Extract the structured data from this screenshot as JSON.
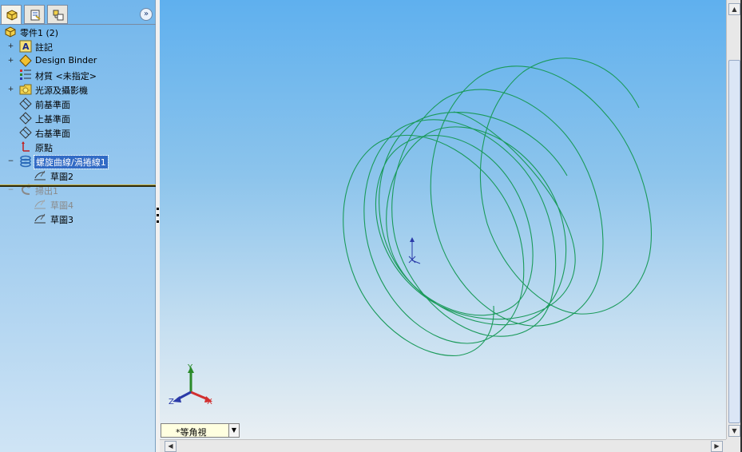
{
  "panel": {
    "tabs": [
      {
        "name": "featuremanager-tab",
        "active": true
      },
      {
        "name": "propertymanager-tab",
        "active": false
      },
      {
        "name": "configurationmanager-tab",
        "active": false
      }
    ],
    "collapse_icon": "double-chevron-right",
    "tree": [
      {
        "label": "零件1  (2)",
        "icon": "part-icon",
        "expander": ""
      },
      {
        "label": "註記",
        "icon": "annotations-icon",
        "expander": "+"
      },
      {
        "label": "Design Binder",
        "icon": "design-binder-icon",
        "expander": "+"
      },
      {
        "label": "材質 <未指定>",
        "icon": "material-icon",
        "expander": ""
      },
      {
        "label": "光源及攝影機",
        "icon": "lights-camera-icon",
        "expander": "+"
      },
      {
        "label": "前基準面",
        "icon": "plane-icon",
        "expander": ""
      },
      {
        "label": "上基準面",
        "icon": "plane-icon",
        "expander": ""
      },
      {
        "label": "右基準面",
        "icon": "plane-icon",
        "expander": ""
      },
      {
        "label": "原點",
        "icon": "origin-icon",
        "expander": ""
      },
      {
        "label": "螺旋曲線/渦捲線1",
        "icon": "helix-icon",
        "expander": "−",
        "selected": true
      },
      {
        "label": "草圖2",
        "icon": "sketch-icon",
        "expander": ""
      },
      {
        "label": "掃出1",
        "icon": "sweep-icon",
        "expander": "−",
        "dimmed": true
      },
      {
        "label": "草圖4",
        "icon": "sketch-icon",
        "expander": "",
        "dimmed": true
      },
      {
        "label": "草圖3",
        "icon": "sketch-icon",
        "expander": ""
      }
    ]
  },
  "viewport": {
    "helix_color": "#1a9a5a",
    "view_orientation": "*等角視",
    "triad": {
      "x": "X",
      "y": "Y",
      "z": "Z"
    }
  },
  "colors": {
    "selection": "#316ac5",
    "triad_x": "#d23030",
    "triad_y": "#2a8a2a",
    "triad_z": "#2a3aa8"
  }
}
